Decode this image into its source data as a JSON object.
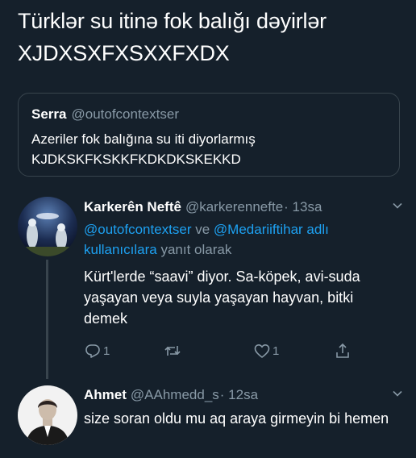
{
  "tweet": {
    "line1": "Türklər su itinə fok balığı dəyirlər",
    "line2": "XJDXSXFXSXXFXDX"
  },
  "quote": {
    "name": "Serra",
    "handle": "@outofcontextser",
    "line1": "Azeriler fok balığına su iti diyorlarmış",
    "line2": "KJDKSKFKSKKFKDKDKSKEKKD"
  },
  "replies": [
    {
      "name": "Karkerên Neftê",
      "handle": "@karkerennefte",
      "time": "· 13sa",
      "mention1": "@outofcontextser",
      "and": " ve ",
      "mention2": "@Medariiftihar adlı kullanıcılara",
      "replying_suffix": " yanıt olarak",
      "body": "Kürt'lerde “saavi” diyor. Sa-köpek, avi-suda yaşayan veya suyla yaşayan hayvan, bitki demek",
      "reply_count": "1",
      "like_count": "1"
    },
    {
      "name": "Ahmet",
      "handle": "@AAhmedd_s",
      "time": "· 12sa",
      "body": "size soran oldu mu aq araya girmeyin bi hemen"
    }
  ],
  "icons": {
    "reply": "reply-icon",
    "retweet": "retweet-icon",
    "like": "like-icon",
    "share": "share-icon",
    "chevron": "chevron-down-icon"
  },
  "colors": {
    "background": "#15202b",
    "text": "#ffffff",
    "secondary": "#8899a6",
    "link": "#1da1f2",
    "border": "#38444d"
  }
}
